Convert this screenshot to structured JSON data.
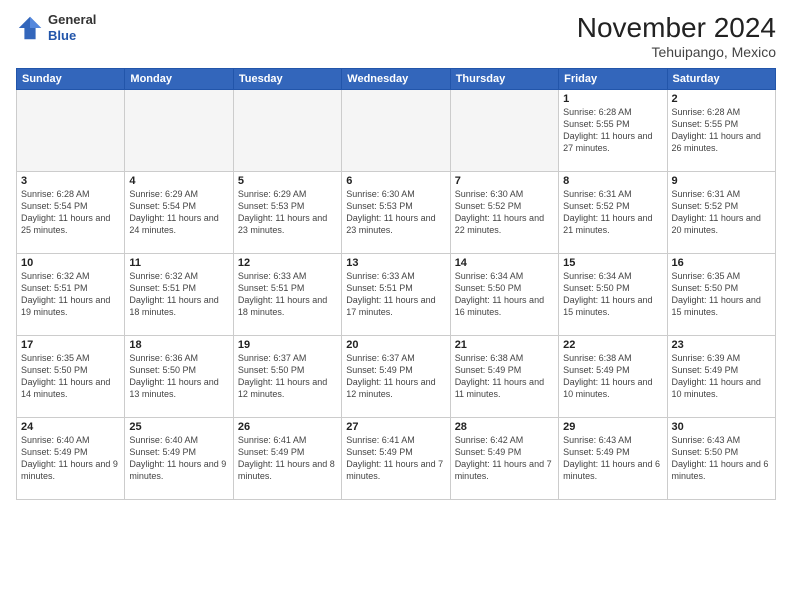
{
  "logo": {
    "general": "General",
    "blue": "Blue"
  },
  "header": {
    "month": "November 2024",
    "location": "Tehuipango, Mexico"
  },
  "weekdays": [
    "Sunday",
    "Monday",
    "Tuesday",
    "Wednesday",
    "Thursday",
    "Friday",
    "Saturday"
  ],
  "weeks": [
    [
      {
        "day": "",
        "info": ""
      },
      {
        "day": "",
        "info": ""
      },
      {
        "day": "",
        "info": ""
      },
      {
        "day": "",
        "info": ""
      },
      {
        "day": "",
        "info": ""
      },
      {
        "day": "1",
        "info": "Sunrise: 6:28 AM\nSunset: 5:55 PM\nDaylight: 11 hours and 27 minutes."
      },
      {
        "day": "2",
        "info": "Sunrise: 6:28 AM\nSunset: 5:55 PM\nDaylight: 11 hours and 26 minutes."
      }
    ],
    [
      {
        "day": "3",
        "info": "Sunrise: 6:28 AM\nSunset: 5:54 PM\nDaylight: 11 hours and 25 minutes."
      },
      {
        "day": "4",
        "info": "Sunrise: 6:29 AM\nSunset: 5:54 PM\nDaylight: 11 hours and 24 minutes."
      },
      {
        "day": "5",
        "info": "Sunrise: 6:29 AM\nSunset: 5:53 PM\nDaylight: 11 hours and 23 minutes."
      },
      {
        "day": "6",
        "info": "Sunrise: 6:30 AM\nSunset: 5:53 PM\nDaylight: 11 hours and 23 minutes."
      },
      {
        "day": "7",
        "info": "Sunrise: 6:30 AM\nSunset: 5:52 PM\nDaylight: 11 hours and 22 minutes."
      },
      {
        "day": "8",
        "info": "Sunrise: 6:31 AM\nSunset: 5:52 PM\nDaylight: 11 hours and 21 minutes."
      },
      {
        "day": "9",
        "info": "Sunrise: 6:31 AM\nSunset: 5:52 PM\nDaylight: 11 hours and 20 minutes."
      }
    ],
    [
      {
        "day": "10",
        "info": "Sunrise: 6:32 AM\nSunset: 5:51 PM\nDaylight: 11 hours and 19 minutes."
      },
      {
        "day": "11",
        "info": "Sunrise: 6:32 AM\nSunset: 5:51 PM\nDaylight: 11 hours and 18 minutes."
      },
      {
        "day": "12",
        "info": "Sunrise: 6:33 AM\nSunset: 5:51 PM\nDaylight: 11 hours and 18 minutes."
      },
      {
        "day": "13",
        "info": "Sunrise: 6:33 AM\nSunset: 5:51 PM\nDaylight: 11 hours and 17 minutes."
      },
      {
        "day": "14",
        "info": "Sunrise: 6:34 AM\nSunset: 5:50 PM\nDaylight: 11 hours and 16 minutes."
      },
      {
        "day": "15",
        "info": "Sunrise: 6:34 AM\nSunset: 5:50 PM\nDaylight: 11 hours and 15 minutes."
      },
      {
        "day": "16",
        "info": "Sunrise: 6:35 AM\nSunset: 5:50 PM\nDaylight: 11 hours and 15 minutes."
      }
    ],
    [
      {
        "day": "17",
        "info": "Sunrise: 6:35 AM\nSunset: 5:50 PM\nDaylight: 11 hours and 14 minutes."
      },
      {
        "day": "18",
        "info": "Sunrise: 6:36 AM\nSunset: 5:50 PM\nDaylight: 11 hours and 13 minutes."
      },
      {
        "day": "19",
        "info": "Sunrise: 6:37 AM\nSunset: 5:50 PM\nDaylight: 11 hours and 12 minutes."
      },
      {
        "day": "20",
        "info": "Sunrise: 6:37 AM\nSunset: 5:49 PM\nDaylight: 11 hours and 12 minutes."
      },
      {
        "day": "21",
        "info": "Sunrise: 6:38 AM\nSunset: 5:49 PM\nDaylight: 11 hours and 11 minutes."
      },
      {
        "day": "22",
        "info": "Sunrise: 6:38 AM\nSunset: 5:49 PM\nDaylight: 11 hours and 10 minutes."
      },
      {
        "day": "23",
        "info": "Sunrise: 6:39 AM\nSunset: 5:49 PM\nDaylight: 11 hours and 10 minutes."
      }
    ],
    [
      {
        "day": "24",
        "info": "Sunrise: 6:40 AM\nSunset: 5:49 PM\nDaylight: 11 hours and 9 minutes."
      },
      {
        "day": "25",
        "info": "Sunrise: 6:40 AM\nSunset: 5:49 PM\nDaylight: 11 hours and 9 minutes."
      },
      {
        "day": "26",
        "info": "Sunrise: 6:41 AM\nSunset: 5:49 PM\nDaylight: 11 hours and 8 minutes."
      },
      {
        "day": "27",
        "info": "Sunrise: 6:41 AM\nSunset: 5:49 PM\nDaylight: 11 hours and 7 minutes."
      },
      {
        "day": "28",
        "info": "Sunrise: 6:42 AM\nSunset: 5:49 PM\nDaylight: 11 hours and 7 minutes."
      },
      {
        "day": "29",
        "info": "Sunrise: 6:43 AM\nSunset: 5:49 PM\nDaylight: 11 hours and 6 minutes."
      },
      {
        "day": "30",
        "info": "Sunrise: 6:43 AM\nSunset: 5:50 PM\nDaylight: 11 hours and 6 minutes."
      }
    ]
  ]
}
